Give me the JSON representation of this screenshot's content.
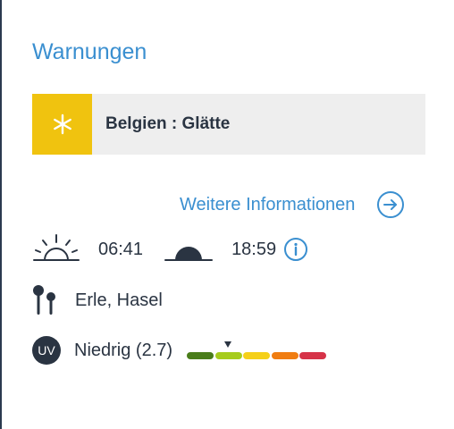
{
  "warnings": {
    "title": "Warnungen",
    "item": {
      "text": "Belgien : Glätte",
      "icon": "snowflake-icon",
      "color": "#f0c30f"
    },
    "more_link": {
      "label": "Weitere Informationen",
      "icon": "arrow-right-circle-icon"
    }
  },
  "sun": {
    "sunrise_icon": "sunrise-icon",
    "sunrise": "06:41",
    "sunset_icon": "sunset-icon",
    "sunset": "18:59",
    "info_icon": "info-icon"
  },
  "pollen": {
    "icon": "pollen-icon",
    "text": "Erle, Hasel"
  },
  "uv": {
    "badge": "UV",
    "text": "Niedrig (2.7)",
    "level": 2.7,
    "scale_colors": [
      "#4a7d1a",
      "#a6cc1c",
      "#f5d019",
      "#f07d11",
      "#d63348"
    ],
    "marker_segment": 1
  },
  "colors": {
    "accent": "#3a8fd0",
    "text": "#2a3442",
    "warning_bg": "#eeeeee"
  }
}
